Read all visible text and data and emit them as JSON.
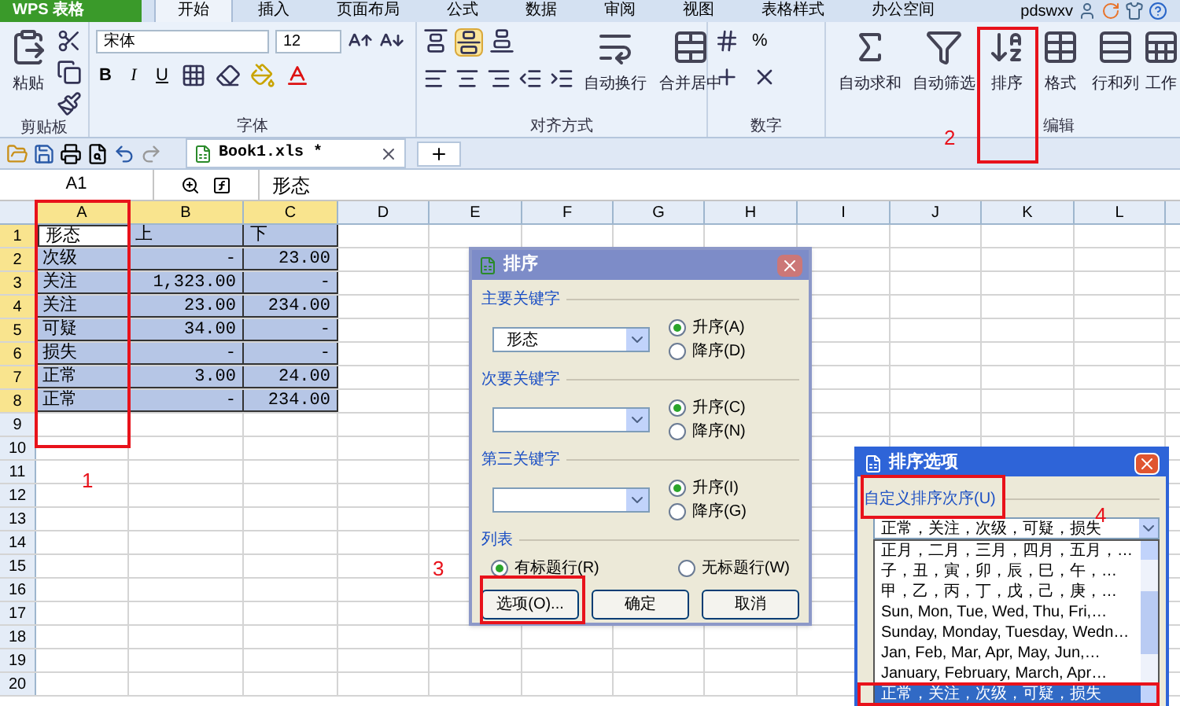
{
  "app_button": {
    "label": "WPS 表格"
  },
  "tabs": [
    {
      "label": "开始",
      "selected": true
    },
    {
      "label": "插入",
      "selected": false
    },
    {
      "label": "页面布局",
      "selected": false
    },
    {
      "label": "公式",
      "selected": false
    },
    {
      "label": "数据",
      "selected": false
    },
    {
      "label": "审阅",
      "selected": false
    },
    {
      "label": "视图",
      "selected": false
    },
    {
      "label": "表格样式",
      "selected": false
    },
    {
      "label": "办公空间",
      "selected": false
    }
  ],
  "account": {
    "name": "pdswxv"
  },
  "ribbon": {
    "clipboard": {
      "paste": "粘贴",
      "title": "剪贴板"
    },
    "font": {
      "name": "宋体",
      "size": "12",
      "styles": [
        "B",
        "I",
        "U"
      ],
      "title": "字体"
    },
    "alignment": {
      "wrap": "自动换行",
      "merge": "合并居中",
      "title": "对齐方式"
    },
    "number": {
      "percent": "%",
      "title": "数字"
    },
    "editing": {
      "buttons": [
        "自动求和",
        "自动筛选",
        "排序",
        "格式",
        "行和列",
        "工作"
      ],
      "title": "编辑"
    }
  },
  "document_tab": {
    "title": "Book1.xls *"
  },
  "formula_bar": {
    "cell": "A1",
    "value": "形态"
  },
  "sheet": {
    "columns": [
      {
        "label": "A",
        "selected": true
      },
      {
        "label": "B",
        "selected": true
      },
      {
        "label": "C",
        "selected": true
      },
      {
        "label": "D",
        "selected": false
      },
      {
        "label": "E",
        "selected": false
      },
      {
        "label": "F",
        "selected": false
      },
      {
        "label": "G",
        "selected": false
      },
      {
        "label": "H",
        "selected": false
      },
      {
        "label": "I",
        "selected": false
      },
      {
        "label": "J",
        "selected": false
      },
      {
        "label": "K",
        "selected": false
      },
      {
        "label": "L",
        "selected": false
      }
    ],
    "rows": [
      {
        "number": "1",
        "selected": true,
        "cells": [
          {
            "text": "形态",
            "active": true
          },
          {
            "text": "上",
            "active": false
          },
          {
            "text": "下",
            "active": false
          }
        ]
      },
      {
        "number": "2",
        "selected": true,
        "cells": [
          {
            "text": "次级",
            "active": false
          },
          {
            "text": "-",
            "active": false
          },
          {
            "text": "23.00",
            "active": false
          }
        ]
      },
      {
        "number": "3",
        "selected": true,
        "cells": [
          {
            "text": "关注",
            "active": false
          },
          {
            "text": "1,323.00",
            "active": false
          },
          {
            "text": "-",
            "active": false
          }
        ]
      },
      {
        "number": "4",
        "selected": true,
        "cells": [
          {
            "text": "关注",
            "active": false
          },
          {
            "text": "23.00",
            "active": false
          },
          {
            "text": "234.00",
            "active": false
          }
        ]
      },
      {
        "number": "5",
        "selected": true,
        "cells": [
          {
            "text": "可疑",
            "active": false
          },
          {
            "text": "34.00",
            "active": false
          },
          {
            "text": "-",
            "active": false
          }
        ]
      },
      {
        "number": "6",
        "selected": true,
        "cells": [
          {
            "text": "损失",
            "active": false
          },
          {
            "text": "-",
            "active": false
          },
          {
            "text": "-",
            "active": false
          }
        ]
      },
      {
        "number": "7",
        "selected": true,
        "cells": [
          {
            "text": "正常",
            "active": false
          },
          {
            "text": "3.00",
            "active": false
          },
          {
            "text": "24.00",
            "active": false
          }
        ]
      },
      {
        "number": "8",
        "selected": true,
        "cells": [
          {
            "text": "正常",
            "active": false
          },
          {
            "text": "-",
            "active": false
          },
          {
            "text": "234.00",
            "active": false
          }
        ]
      },
      {
        "number": "9",
        "selected": false,
        "cells": []
      },
      {
        "number": "10",
        "selected": false,
        "cells": []
      },
      {
        "number": "11",
        "selected": false,
        "cells": []
      },
      {
        "number": "12",
        "selected": false,
        "cells": []
      },
      {
        "number": "13",
        "selected": false,
        "cells": []
      },
      {
        "number": "14",
        "selected": false,
        "cells": []
      },
      {
        "number": "15",
        "selected": false,
        "cells": []
      },
      {
        "number": "16",
        "selected": false,
        "cells": []
      },
      {
        "number": "17",
        "selected": false,
        "cells": []
      },
      {
        "number": "18",
        "selected": false,
        "cells": []
      },
      {
        "number": "19",
        "selected": false,
        "cells": []
      },
      {
        "number": "20",
        "selected": false,
        "cells": []
      }
    ]
  },
  "sort_dialog": {
    "title": "排序",
    "keys": [
      {
        "label": "主要关键字",
        "value": "形态",
        "options": [
          {
            "label": "升序(A)",
            "selected": true
          },
          {
            "label": "降序(D)",
            "selected": false
          }
        ]
      },
      {
        "label": "次要关键字",
        "options": [
          {
            "label": "升序(C)",
            "selected": true
          },
          {
            "label": "降序(N)",
            "selected": false
          }
        ]
      },
      {
        "label": "第三关键字",
        "options": [
          {
            "label": "升序(I)",
            "selected": true
          },
          {
            "label": "降序(G)",
            "selected": false
          }
        ]
      }
    ],
    "header": {
      "label": "列表",
      "options": [
        {
          "label": "有标题行(R)",
          "selected": true
        },
        {
          "label": "无标题行(W)",
          "selected": false
        }
      ]
    },
    "buttons": [
      "选项(O)...",
      "确定",
      "取消"
    ]
  },
  "options_dialog": {
    "title": "排序选项",
    "section": "自定义排序次序(U)",
    "value": "正常，关注，次级，可疑，损失",
    "list": [
      {
        "text": "正月，二月，三月，四月，五月，…",
        "selected": false
      },
      {
        "text": "子，丑，寅，卯，辰，巳，午，…",
        "selected": false
      },
      {
        "text": "甲，乙，丙，丁，戊，己，庚，…",
        "selected": false
      },
      {
        "text": "Sun, Mon, Tue, Wed, Thu, Fri,…",
        "selected": false
      },
      {
        "text": "Sunday, Monday, Tuesday, Wedn…",
        "selected": false
      },
      {
        "text": "Jan, Feb, Mar, Apr, May, Jun,…",
        "selected": false
      },
      {
        "text": "January, February, March, Apr…",
        "selected": false
      },
      {
        "text": "正常，关注，次级，可疑，损失",
        "selected": true
      }
    ]
  },
  "annotations": [
    {
      "label": "1"
    },
    {
      "label": "2"
    },
    {
      "label": "3"
    },
    {
      "label": "4"
    }
  ]
}
